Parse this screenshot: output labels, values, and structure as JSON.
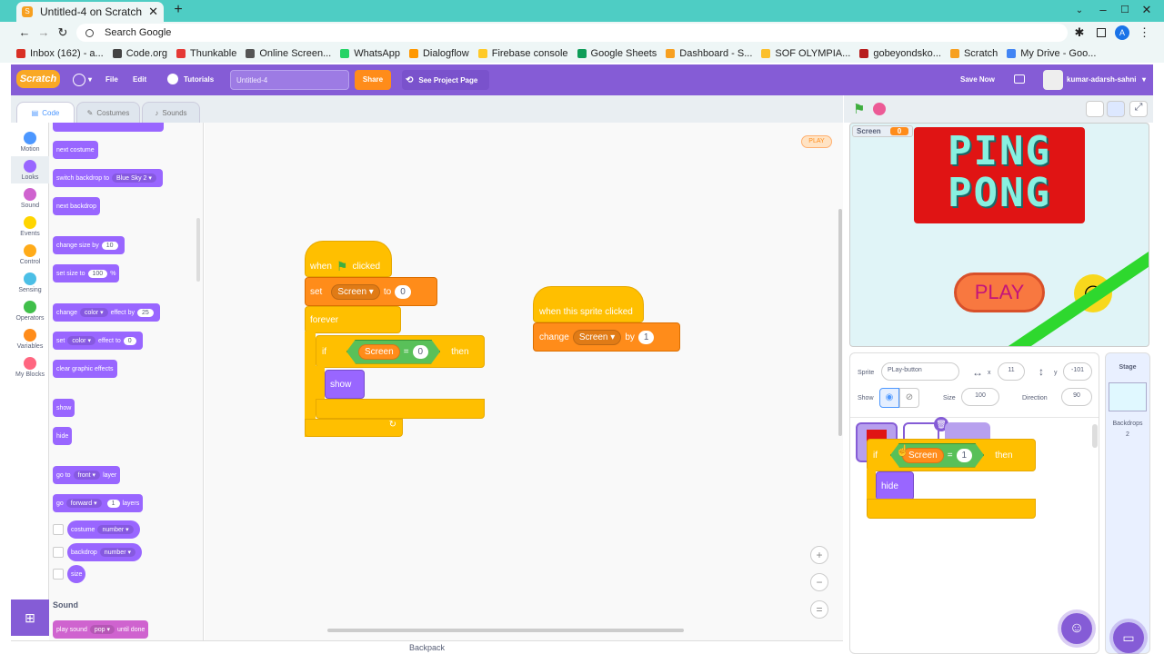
{
  "browser": {
    "tab_title": "Untitled-4 on Scratch",
    "omnibox_text": "Search Google",
    "bookmarks": [
      {
        "label": "Inbox (162) - a...",
        "color": "#d93025"
      },
      {
        "label": "Code.org",
        "color": "#444444"
      },
      {
        "label": "Thunkable",
        "color": "#e53935"
      },
      {
        "label": "Online Screen...",
        "color": "#555555"
      },
      {
        "label": "WhatsApp",
        "color": "#25d366"
      },
      {
        "label": "Dialogflow",
        "color": "#ff9800"
      },
      {
        "label": "Firebase console",
        "color": "#ffca28"
      },
      {
        "label": "Google Sheets",
        "color": "#0f9d58"
      },
      {
        "label": "Dashboard - S...",
        "color": "#f7a020"
      },
      {
        "label": "SOF OLYMPIA...",
        "color": "#fbc02d"
      },
      {
        "label": "gobeyondsko...",
        "color": "#b71c1c"
      },
      {
        "label": "Scratch",
        "color": "#f7a020"
      },
      {
        "label": "My Drive - Goo...",
        "color": "#4285f4"
      }
    ]
  },
  "menubar": {
    "logo": "Scratch",
    "file": "File",
    "edit": "Edit",
    "tutorials": "Tutorials",
    "project_title": "Untitled-4",
    "share": "Share",
    "see_project_page": "See Project Page",
    "save_now": "Save Now",
    "username": "kumar-adarsh-sahni"
  },
  "editor_tabs": {
    "code": "Code",
    "costumes": "Costumes",
    "sounds": "Sounds"
  },
  "categories": [
    {
      "label": "Motion",
      "color": "#4c97ff"
    },
    {
      "label": "Looks",
      "color": "#9966ff"
    },
    {
      "label": "Sound",
      "color": "#cf63cf"
    },
    {
      "label": "Events",
      "color": "#ffd500"
    },
    {
      "label": "Control",
      "color": "#ffab19"
    },
    {
      "label": "Sensing",
      "color": "#4cbfe6"
    },
    {
      "label": "Operators",
      "color": "#40bf4a"
    },
    {
      "label": "Variables",
      "color": "#ff8c1a"
    },
    {
      "label": "My Blocks",
      "color": "#ff6680"
    }
  ],
  "palette": {
    "next_costume": "next costume",
    "switch_backdrop": "switch backdrop to",
    "switch_backdrop_value": "Blue Sky 2",
    "next_backdrop": "next backdrop",
    "change_size": "change size by",
    "change_size_value": "10",
    "set_size": "set size to",
    "set_size_value": "100",
    "percent": "%",
    "change_effect": "change",
    "effect_color": "color",
    "effect_by": "effect by",
    "change_effect_value": "25",
    "set_effect": "set",
    "effect_to": "effect to",
    "set_effect_value": "0",
    "clear_effects": "clear graphic effects",
    "show": "show",
    "hide": "hide",
    "go_to": "go to",
    "front": "front",
    "layer": "layer",
    "go": "go",
    "forward": "forward",
    "layers_value": "1",
    "layers": "layers",
    "costume": "costume",
    "number": "number",
    "backdrop": "backdrop",
    "size": "size",
    "sound_header": "Sound",
    "play_sound": "play sound",
    "pop": "pop",
    "until_done": "until done"
  },
  "workspace": {
    "script1": {
      "when": "when",
      "clicked": "clicked",
      "set": "set",
      "var": "Screen",
      "to": "to",
      "value": "0",
      "forever": "forever",
      "if": "if",
      "eq_left": "Screen",
      "eq": "=",
      "eq_right": "0",
      "then": "then",
      "show": "show"
    },
    "script2": {
      "hat": "when this sprite clicked",
      "change": "change",
      "var": "Screen",
      "by": "by",
      "value": "1"
    },
    "dragging": {
      "if": "if",
      "eq_left": "Screen",
      "eq": "=",
      "eq_right": "1",
      "then": "then",
      "hide": "hide"
    },
    "play_label": "PLAY",
    "backpack": "Backpack"
  },
  "stage": {
    "var_monitor_name": "Screen",
    "var_monitor_value": "0",
    "title_line1": "PING",
    "title_line2": "PONG",
    "play": "PLAY"
  },
  "sprite_info": {
    "sprite_label": "Sprite",
    "sprite_name": "PLay-button",
    "x_label": "x",
    "x": "11",
    "y_label": "y",
    "y": "-101",
    "show_label": "Show",
    "size_label": "Size",
    "size": "100",
    "direction_label": "Direction",
    "direction": "90"
  },
  "stage_panel": {
    "label": "Stage",
    "backdrops_label": "Backdrops",
    "backdrops_count": "2"
  }
}
